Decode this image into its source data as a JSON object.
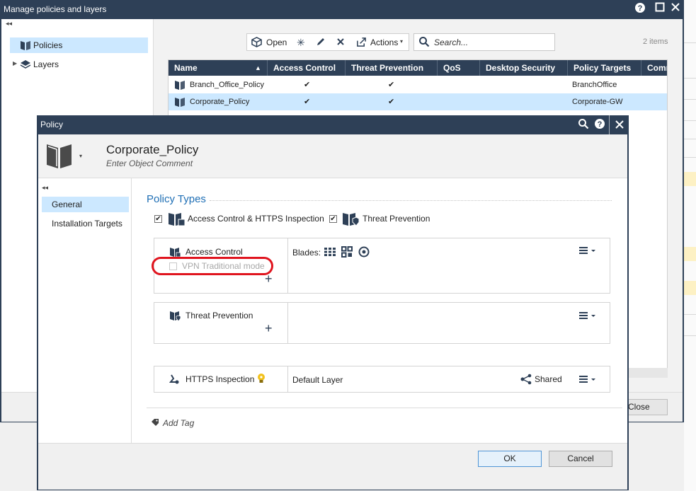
{
  "outer_window": {
    "title": "Manage policies and layers",
    "tree": [
      {
        "label": "Policies",
        "selected": true
      },
      {
        "label": "Layers",
        "selected": false
      }
    ],
    "toolbar": {
      "open_label": "Open",
      "actions_label": "Actions",
      "search_placeholder": "Search..."
    },
    "item_count": "2 items",
    "columns": [
      "Name",
      "Access Control",
      "Threat Prevention",
      "QoS",
      "Desktop Security",
      "Policy Targets",
      "Comm"
    ],
    "rows": [
      {
        "name": "Branch_Office_Policy",
        "access_control": "✔",
        "threat_prevention": "✔",
        "qos": "",
        "desktop_security": "",
        "policy_targets": "BranchOffice"
      },
      {
        "name": "Corporate_Policy",
        "access_control": "✔",
        "threat_prevention": "✔",
        "qos": "",
        "desktop_security": "",
        "policy_targets": "Corporate-GW"
      }
    ],
    "close_label": "Close"
  },
  "policy_dialog": {
    "title": "Policy",
    "object_name": "Corporate_Policy",
    "comment_placeholder": "Enter Object Comment",
    "nav": [
      {
        "label": "General",
        "selected": true
      },
      {
        "label": "Installation Targets",
        "selected": false
      }
    ],
    "section_title": "Policy Types",
    "policy_types": [
      {
        "label": "Access Control & HTTPS Inspection",
        "checked": true
      },
      {
        "label": "Threat Prevention",
        "checked": true
      }
    ],
    "access_control": {
      "label": "Access Control",
      "vpn_mode_label": "VPN Traditional mode",
      "vpn_mode_checked": false,
      "blades_label": "Blades:"
    },
    "threat_prevention": {
      "label": "Threat Prevention"
    },
    "https_inspection": {
      "label": "HTTPS Inspection",
      "layer": "Default Layer",
      "shared_label": "Shared"
    },
    "add_tag_label": "Add Tag",
    "ok_label": "OK",
    "cancel_label": "Cancel"
  },
  "colors": {
    "titlebar": "#2e4057",
    "selection": "#cce8ff",
    "accent_text": "#1f6fb5",
    "highlight_annotation": "#e0141e"
  }
}
